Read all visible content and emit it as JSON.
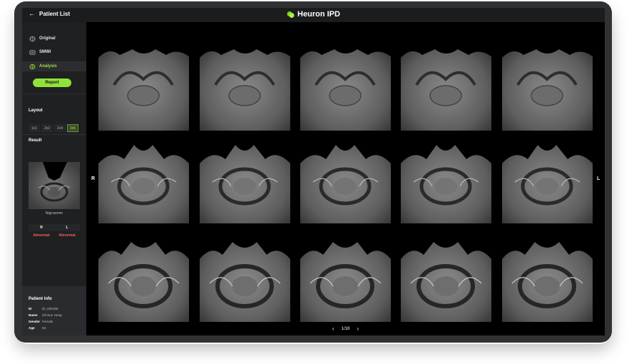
{
  "header": {
    "back_label": "Patient List",
    "app_title": "Heuron IPD"
  },
  "sidebar": {
    "nav": [
      {
        "label": "Original",
        "icon": "brain-icon"
      },
      {
        "label": "SMWI",
        "icon": "brain-scan-icon"
      },
      {
        "label": "Analysis",
        "icon": "brain-analysis-icon",
        "active": true
      }
    ],
    "report_label": "Report",
    "layout_title": "Layout",
    "layout_options": [
      "1x1",
      "2x2",
      "2x4",
      "3x5"
    ],
    "layout_selected": "3x5",
    "result_title": "Result",
    "result_caption": "Nigrosome",
    "result_sides": [
      "R",
      "L"
    ],
    "result_values": [
      "Abnormal",
      "Abnormal"
    ]
  },
  "patient": {
    "title": "Patient info",
    "rows": [
      {
        "key": "ID",
        "value": "ID_000155"
      },
      {
        "key": "Name",
        "value": "Gil-Sun Hong"
      },
      {
        "key": "Gender",
        "value": "Female"
      },
      {
        "key": "Age",
        "value": "63"
      }
    ]
  },
  "viewer": {
    "left_label": "R",
    "right_label": "L",
    "page": "1/18"
  },
  "colors": {
    "accent": "#8fe33a",
    "abnormal": "#ff5a5a"
  }
}
